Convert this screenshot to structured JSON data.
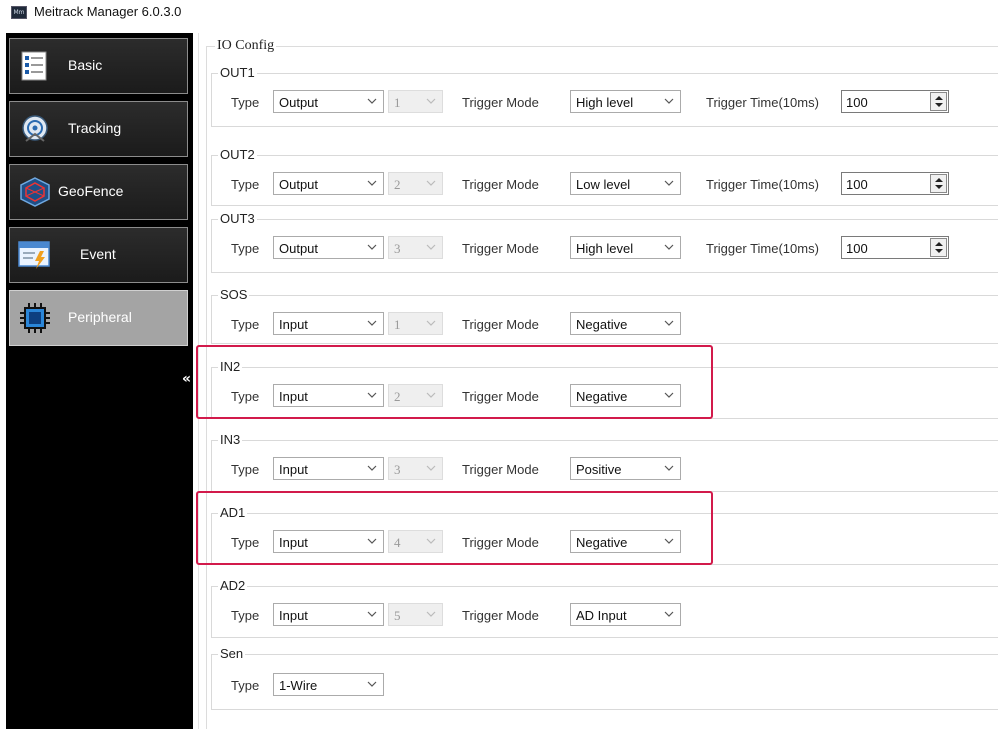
{
  "window": {
    "title": "Meitrack Manager 6.0.3.0",
    "icon_text": "Mm"
  },
  "sidebar": {
    "collapse_label": "«",
    "items": [
      {
        "label": "Basic",
        "icon": "basic-list-icon",
        "active": false
      },
      {
        "label": "Tracking",
        "icon": "satellite-dish-icon",
        "active": false
      },
      {
        "label": "GeoFence",
        "icon": "geofence-network-icon",
        "active": false
      },
      {
        "label": "Event",
        "icon": "event-lightning-icon",
        "active": false
      },
      {
        "label": "Peripheral",
        "icon": "chip-icon",
        "active": true
      }
    ]
  },
  "io_config": {
    "title": "IO Config",
    "type_label": "Type",
    "trigger_mode_label": "Trigger Mode",
    "trigger_time_label": "Trigger Time(10ms)",
    "ports": [
      {
        "name": "OUT1",
        "type": "Output",
        "index": "1",
        "trigger_mode": "High level",
        "trigger_time": "100",
        "highlighted": false
      },
      {
        "name": "OUT2",
        "type": "Output",
        "index": "2",
        "trigger_mode": "Low level",
        "trigger_time": "100",
        "highlighted": false
      },
      {
        "name": "OUT3",
        "type": "Output",
        "index": "3",
        "trigger_mode": "High level",
        "trigger_time": "100",
        "highlighted": false
      },
      {
        "name": "SOS",
        "type": "Input",
        "index": "1",
        "trigger_mode": "Negative",
        "highlighted": false
      },
      {
        "name": "IN2",
        "type": "Input",
        "index": "2",
        "trigger_mode": "Negative",
        "highlighted": true
      },
      {
        "name": "IN3",
        "type": "Input",
        "index": "3",
        "trigger_mode": "Positive",
        "highlighted": false
      },
      {
        "name": "AD1",
        "type": "Input",
        "index": "4",
        "trigger_mode": "Negative",
        "highlighted": true
      },
      {
        "name": "AD2",
        "type": "Input",
        "index": "5",
        "trigger_mode": "AD Input",
        "highlighted": false
      }
    ],
    "sen": {
      "name": "Sen",
      "type": "1-Wire"
    }
  },
  "colors": {
    "sidebar_bg": "#000000",
    "active_item": "#a4a4a4",
    "highlight": "#d21a4b"
  }
}
